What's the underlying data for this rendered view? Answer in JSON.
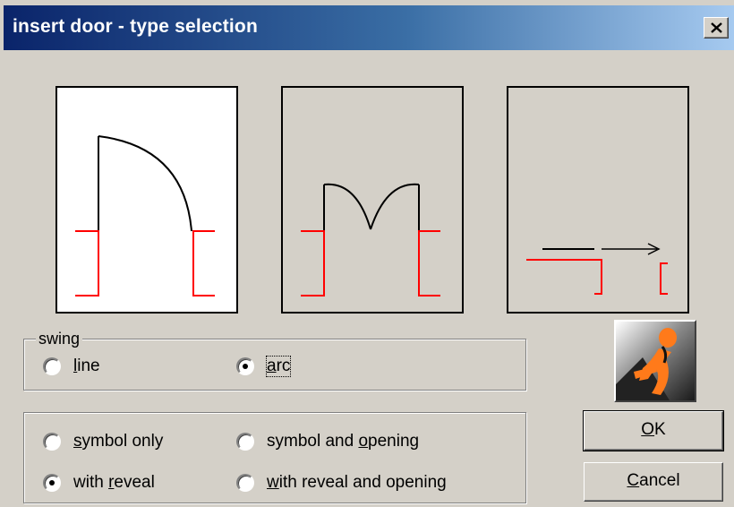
{
  "window": {
    "title": "insert door - type selection",
    "close_label": "X"
  },
  "previews": [
    {
      "name": "door-swing-arc-preview"
    },
    {
      "name": "double-door-preview"
    },
    {
      "name": "sliding-door-preview"
    }
  ],
  "swing": {
    "legend": "swing",
    "options": [
      {
        "label_pre": "",
        "label_u": "l",
        "label_post": "ine",
        "selected": false
      },
      {
        "label_pre": "",
        "label_u": "a",
        "label_post": "rc",
        "selected": true
      }
    ]
  },
  "type": {
    "options": [
      {
        "label_pre": "",
        "label_u": "s",
        "label_post": "ymbol only",
        "selected": false
      },
      {
        "label_pre": "symbol and ",
        "label_u": "o",
        "label_post": "pening",
        "selected": false
      },
      {
        "label_pre": "with ",
        "label_u": "r",
        "label_post": "eveal",
        "selected": true
      },
      {
        "label_pre": "",
        "label_u": "w",
        "label_post": "ith reveal and opening",
        "selected": false
      }
    ]
  },
  "buttons": {
    "ok": {
      "label_u": "O",
      "label_post": "K"
    },
    "cancel": {
      "label_u": "C",
      "label_post": "ancel"
    }
  },
  "colors": {
    "accent_red": "#ff0000",
    "logo_orange": "#ff7a1a"
  },
  "logo": {
    "icon": "figure-logo-icon"
  }
}
